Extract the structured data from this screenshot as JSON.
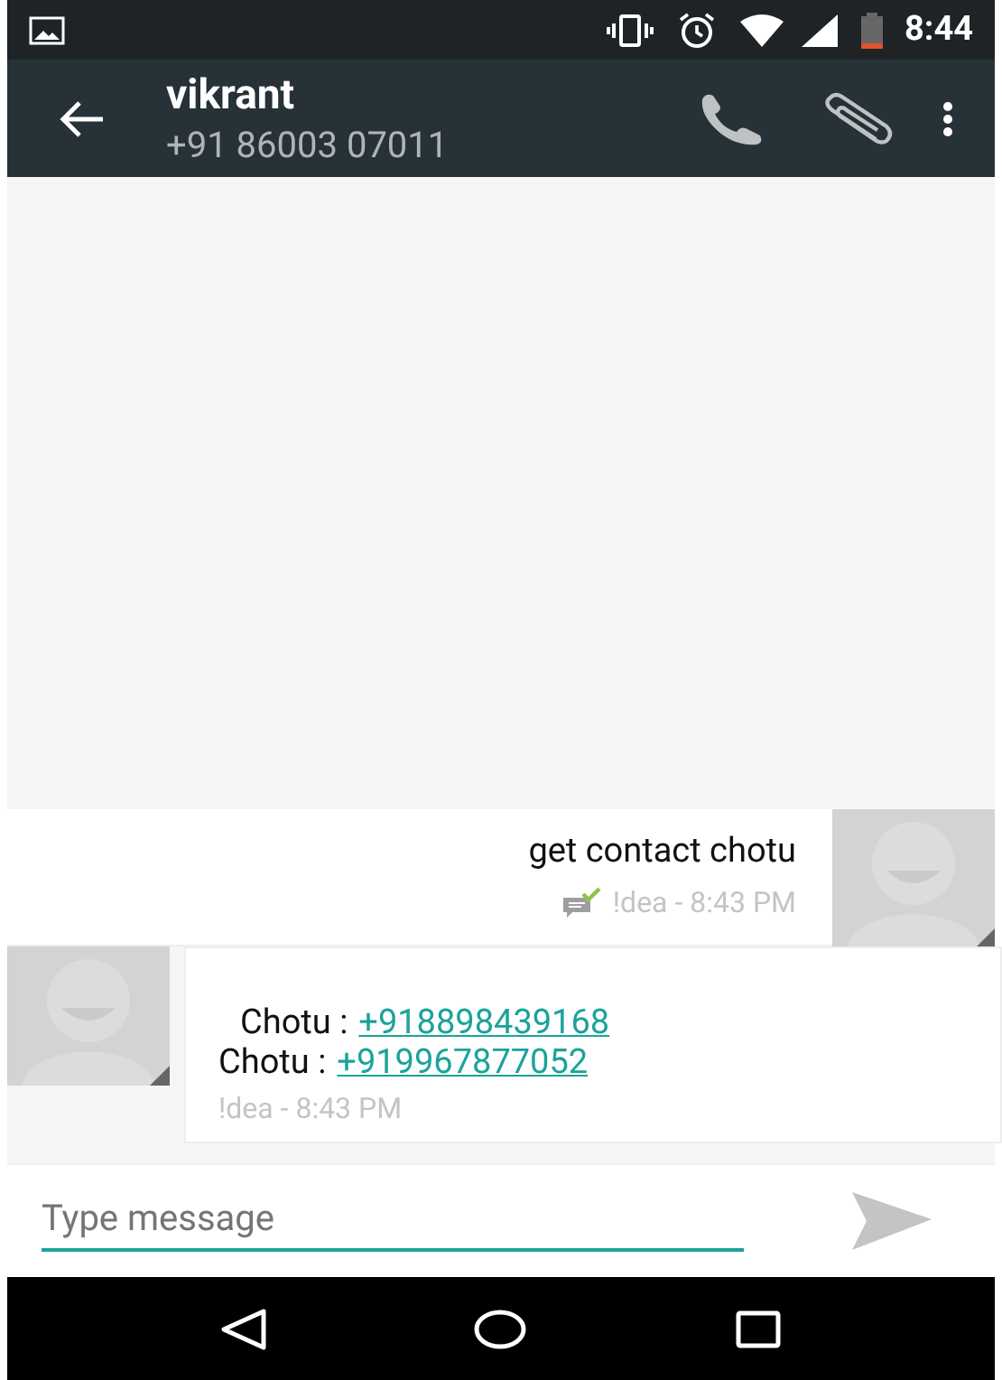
{
  "status_bar": {
    "time": "8:44"
  },
  "toolbar": {
    "title": "vikrant",
    "subtitle": "+91 86003 07011"
  },
  "messages": [
    {
      "kind": "outgoing",
      "text": "get contact chotu",
      "delivered": true,
      "meta": "!dea - 8:43 PM"
    },
    {
      "kind": "incoming",
      "lines": [
        {
          "label": "Chotu :",
          "number": "+918898439168"
        },
        {
          "label": "Chotu :",
          "number": "+919967877052"
        }
      ],
      "meta": "!dea - 8:43 PM"
    }
  ],
  "composer": {
    "placeholder": "Type message"
  }
}
